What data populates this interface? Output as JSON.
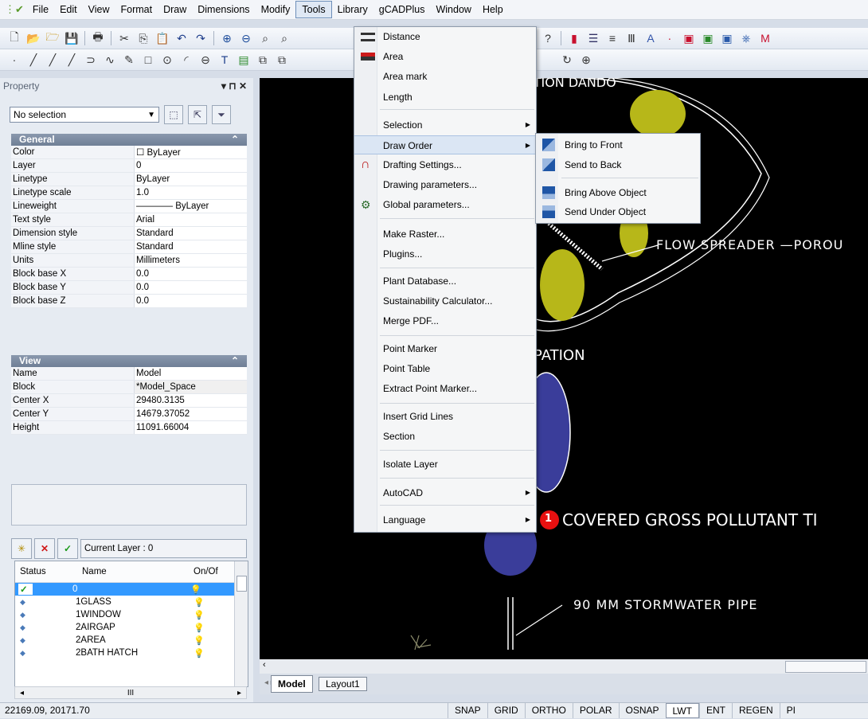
{
  "menubar": [
    "File",
    "Edit",
    "View",
    "Format",
    "Draw",
    "Dimensions",
    "Modify",
    "Tools",
    "Library",
    "gCADPlus",
    "Window",
    "Help"
  ],
  "property_panel": {
    "title": "Property",
    "title_controls": "▾ ⊓ ✕",
    "selection": "No selection",
    "general": {
      "header": "General",
      "rows": [
        {
          "k": "Color",
          "v": "☐ ByLayer"
        },
        {
          "k": "Layer",
          "v": "0"
        },
        {
          "k": "Linetype",
          "v": "ByLayer"
        },
        {
          "k": "Linetype scale",
          "v": "1.0"
        },
        {
          "k": "Lineweight",
          "v": "———— ByLayer"
        },
        {
          "k": "Text style",
          "v": "Arial"
        },
        {
          "k": "Dimension style",
          "v": "Standard"
        },
        {
          "k": "Mline style",
          "v": "Standard"
        },
        {
          "k": "Units",
          "v": "Millimeters"
        },
        {
          "k": "Block base X",
          "v": "0.0"
        },
        {
          "k": "Block base Y",
          "v": "0.0"
        },
        {
          "k": "Block base Z",
          "v": "0.0"
        }
      ]
    },
    "view": {
      "header": "View",
      "rows": [
        {
          "k": "Name",
          "v": "Model"
        },
        {
          "k": "Block",
          "v": "*Model_Space"
        },
        {
          "k": "Center X",
          "v": "29480.3135"
        },
        {
          "k": "Center Y",
          "v": "14679.37052"
        },
        {
          "k": "Height",
          "v": "11091.66004"
        }
      ]
    },
    "current_layer": "Current Layer : 0",
    "layer_columns": [
      "Status",
      "Name",
      "On/Of"
    ],
    "layers": [
      {
        "status": "✓",
        "name": "0"
      },
      {
        "status": "◆",
        "name": "1GLASS"
      },
      {
        "status": "◆",
        "name": "1WINDOW"
      },
      {
        "status": "◆",
        "name": "2AIRGAP"
      },
      {
        "status": "◆",
        "name": "2AREA"
      },
      {
        "status": "◆",
        "name": "2BATH HATCH"
      }
    ],
    "scroll_mark": "III"
  },
  "canvas": {
    "labels": {
      "flow_spreader": "FLOW SPREADER —POROU",
      "pation": "PATION",
      "covered": "COVERED GROSS POLLUTANT TI",
      "pipe": "90 MM STORMWATER PIPE",
      "top_text": "ATION DANDO",
      "badge": "1"
    }
  },
  "tabs": [
    "Model",
    "Layout1"
  ],
  "status": {
    "coords": "22169.09,  20171.70",
    "buttons": [
      "SNAP",
      "GRID",
      "ORTHO",
      "POLAR",
      "OSNAP",
      "LWT",
      "ENT",
      "REGEN",
      "PI"
    ]
  },
  "tools_menu": {
    "items": [
      "Distance",
      "Area",
      "Area mark",
      "Length",
      "Selection",
      "Draw Order",
      "Drafting Settings...",
      "Drawing parameters...",
      "Global parameters...",
      "Make Raster...",
      "Plugins...",
      "Plant Database...",
      "Sustainability Calculator...",
      "Merge PDF...",
      "Point Marker",
      "Point Table",
      "Extract Point Marker...",
      "Insert Grid Lines",
      "Section",
      "Isolate Layer",
      "AutoCAD",
      "Language"
    ]
  },
  "draw_order_submenu": {
    "items": [
      "Bring to Front",
      "Send to Back",
      "Bring Above Object",
      "Send Under Object"
    ]
  },
  "colors": {
    "canvas": "#000000",
    "menu_hl": "#dbe6f4",
    "badge": "#e81010",
    "shape_yellow": "#b7b719",
    "shape_blue": "#3a3d9a"
  }
}
